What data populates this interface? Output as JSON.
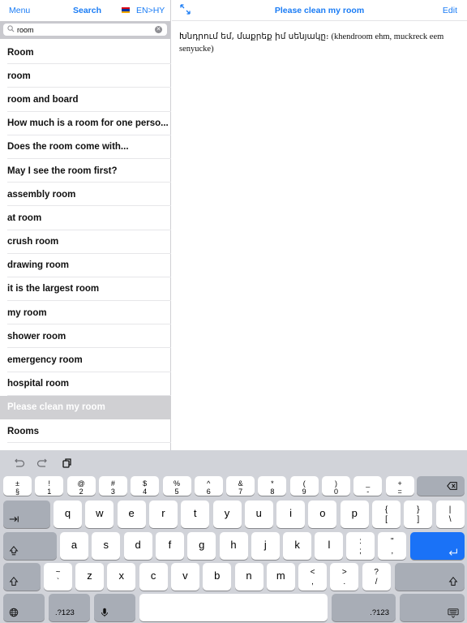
{
  "left_header": {
    "menu_label": "Menu",
    "search_label": "Search",
    "flag_icon": "armenia-flag-icon",
    "flag_colors": [
      "#d90012",
      "#0033a0",
      "#f2a800"
    ],
    "language_pair": "EN>HY"
  },
  "search": {
    "value": "room",
    "placeholder": "Search"
  },
  "results": [
    {
      "label": "Room",
      "selected": false
    },
    {
      "label": "room",
      "selected": false
    },
    {
      "label": "room and board",
      "selected": false
    },
    {
      "label": "How much is a room for one perso...",
      "selected": false
    },
    {
      "label": "Does the room come with...",
      "selected": false
    },
    {
      "label": "May I see the room first?",
      "selected": false
    },
    {
      "label": "assembly room",
      "selected": false
    },
    {
      "label": "at room",
      "selected": false
    },
    {
      "label": "crush room",
      "selected": false
    },
    {
      "label": "drawing room",
      "selected": false
    },
    {
      "label": "it is the largest room",
      "selected": false
    },
    {
      "label": "my room",
      "selected": false
    },
    {
      "label": "shower room",
      "selected": false
    },
    {
      "label": "emergency room",
      "selected": false
    },
    {
      "label": "hospital room",
      "selected": false
    },
    {
      "label": "Please clean my room",
      "selected": true
    },
    {
      "label": "Rooms",
      "selected": false
    }
  ],
  "detail": {
    "title": "Please clean my room",
    "edit_label": "Edit",
    "translation_armenian": "Խնդրում եմ, մաքրեք իմ սենյակը։",
    "transliteration": "(khendroom ehm, muckreck eem senyucke)"
  },
  "colors": {
    "accent": "#1a7cf5",
    "selected_row_bg": "#d0d0d3",
    "keyboard_bg": "#d1d3d9",
    "return_key": "#1a72f7"
  },
  "keyboard": {
    "number_row": [
      {
        "top": "±",
        "bot": "§"
      },
      {
        "top": "!",
        "bot": "1"
      },
      {
        "top": "@",
        "bot": "2"
      },
      {
        "top": "#",
        "bot": "3"
      },
      {
        "top": "$",
        "bot": "4"
      },
      {
        "top": "%",
        "bot": "5"
      },
      {
        "top": "^",
        "bot": "6"
      },
      {
        "top": "&",
        "bot": "7"
      },
      {
        "top": "*",
        "bot": "8"
      },
      {
        "top": "(",
        "bot": "9"
      },
      {
        "top": ")",
        "bot": "0"
      },
      {
        "top": "_",
        "bot": "-"
      },
      {
        "top": "+",
        "bot": "="
      }
    ],
    "row_q": [
      "q",
      "w",
      "e",
      "r",
      "t",
      "y",
      "u",
      "i",
      "o",
      "p"
    ],
    "row_q_symbols": [
      {
        "top": "{",
        "bot": "["
      },
      {
        "top": "}",
        "bot": "]"
      },
      {
        "top": "|",
        "bot": "\\"
      }
    ],
    "row_a": [
      "a",
      "s",
      "d",
      "f",
      "g",
      "h",
      "j",
      "k",
      "l"
    ],
    "row_a_symbols": [
      {
        "top": ":",
        "bot": ";"
      },
      {
        "top": "\"",
        "bot": ","
      }
    ],
    "row_z_first": {
      "top": "~",
      "bot": "`"
    },
    "row_z": [
      "z",
      "x",
      "c",
      "v",
      "b",
      "n",
      "m"
    ],
    "row_z_symbols": [
      {
        "top": "<",
        "bot": ","
      },
      {
        "top": ">",
        "bot": "."
      },
      {
        "top": "?",
        "bot": "/"
      }
    ],
    "numbers_label": ".?123"
  }
}
